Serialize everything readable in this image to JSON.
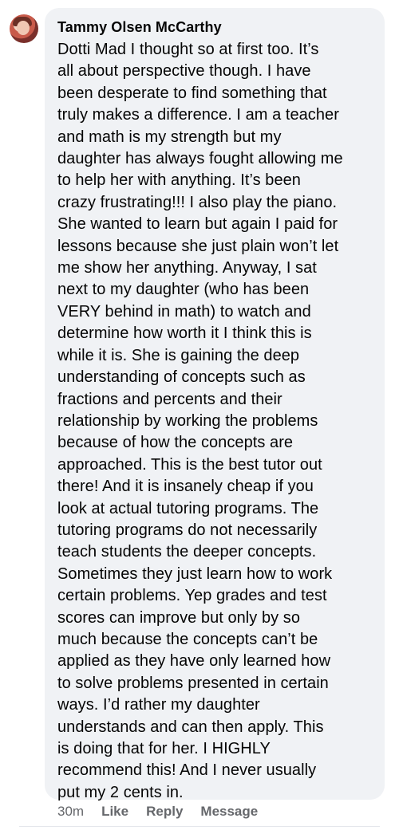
{
  "comment": {
    "author": "Tammy Olsen McCarthy",
    "text": "Dotti Mad  I thought so at first too.  It’s\nall about perspective though.  I have\nbeen desperate to find something that\ntruly makes a difference.  I am a teacher\nand math is my strength but my\ndaughter has always fought allowing me\nto help her with anything.  It’s been\ncrazy frustrating!!!  I also play the piano.\nShe wanted to learn but again I paid for\nlessons because she just plain won’t let\nme show her anything.  Anyway, I sat\nnext to my daughter (who has been\nVERY behind in math) to watch and\ndetermine how worth it I think this is\nwhile it is.  She is gaining the deep\nunderstanding of concepts such as\nfractions and percents and their\nrelationship by working the problems\nbecause of how the concepts are\napproached.  This is the best tutor out\nthere!  And it is insanely cheap if you\nlook at actual tutoring programs.  The\ntutoring programs do not necessarily\nteach students the deeper concepts.\nSometimes they just learn how to work\ncertain problems.  Yep grades and test\nscores can improve but only by so\nmuch because the concepts can’t be\napplied as they have only learned how\nto solve problems presented in certain\nways.  I’d rather my daughter\nunderstands and can then apply.  This\nis doing that for her.  I HIGHLY\nrecommend this!  And I never usually\nput my 2 cents in.",
    "timestamp": "30m",
    "actions": {
      "like": "Like",
      "reply": "Reply",
      "message": "Message"
    }
  },
  "colors": {
    "bubble": "#f0f2f5",
    "text": "#050505",
    "meta": "#65676b"
  }
}
